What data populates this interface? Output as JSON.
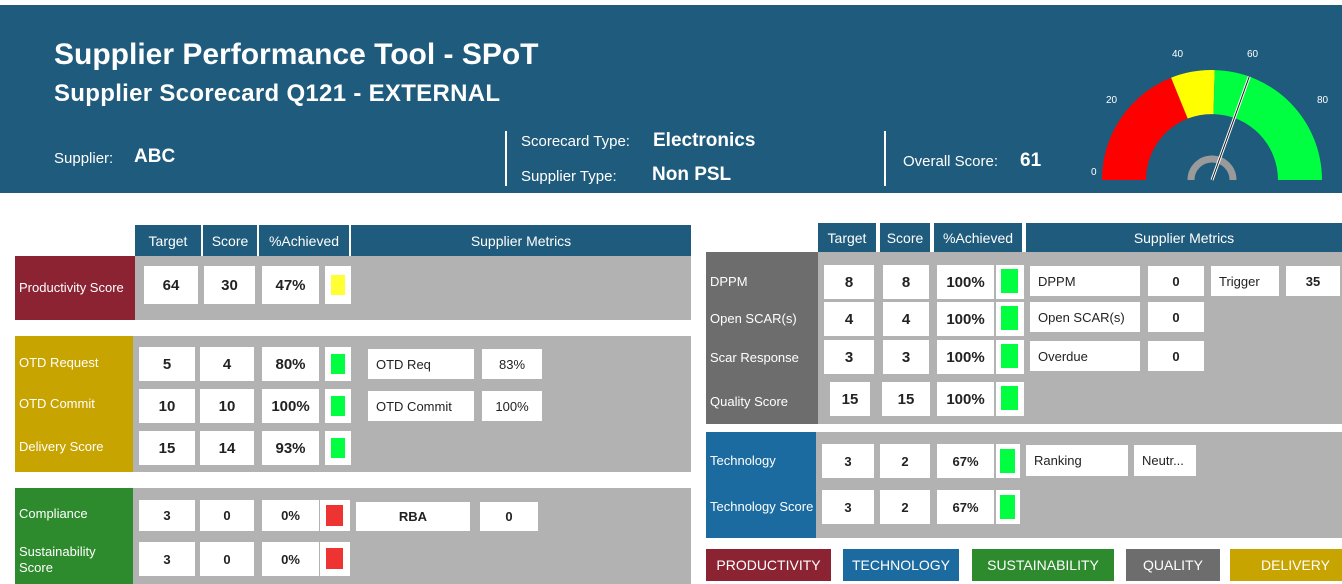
{
  "header": {
    "title": "Supplier Performance Tool - SPoT",
    "subtitle": "Supplier Scorecard Q121 - EXTERNAL",
    "supplier_label": "Supplier:",
    "supplier_value": "ABC",
    "scorecard_type_label": "Scorecard Type:",
    "scorecard_type_value": "Electronics",
    "supplier_type_label": "Supplier Type:",
    "supplier_type_value": "Non PSL",
    "overall_label": "Overall Score:",
    "overall_value": "61"
  },
  "gauge": {
    "ticks": [
      "0",
      "20",
      "40",
      "60",
      "80"
    ],
    "value": 61,
    "min": 0,
    "max": 100,
    "colors": {
      "red": "#ff0000",
      "yellow": "#ffff00",
      "green": "#00ff41"
    }
  },
  "left_headers": {
    "target": "Target",
    "score": "Score",
    "achieved": "%Achieved",
    "metrics": "Supplier Metrics"
  },
  "right_headers": {
    "target": "Target",
    "score": "Score",
    "achieved": "%Achieved",
    "metrics": "Supplier Metrics"
  },
  "productivity": {
    "label": "Productivity Score",
    "target": "64",
    "score": "30",
    "achieved": "47%",
    "status": "yellow"
  },
  "delivery": {
    "rows": [
      {
        "label": "OTD Request",
        "target": "5",
        "score": "4",
        "achieved": "80%",
        "status": "green",
        "metric_name": "OTD Req",
        "metric_value": "83%"
      },
      {
        "label": "OTD Commit",
        "target": "10",
        "score": "10",
        "achieved": "100%",
        "status": "green",
        "metric_name": "OTD Commit",
        "metric_value": "100%"
      },
      {
        "label": "Delivery Score",
        "target": "15",
        "score": "14",
        "achieved": "93%",
        "status": "green"
      }
    ]
  },
  "sustainability": {
    "rows": [
      {
        "label": "Compliance",
        "target": "3",
        "score": "0",
        "achieved": "0%",
        "status": "red",
        "metric_name": "RBA",
        "metric_value": "0"
      },
      {
        "label": "Sustainability Score",
        "target": "3",
        "score": "0",
        "achieved": "0%",
        "status": "red"
      }
    ]
  },
  "quality": {
    "rows": [
      {
        "label": "DPPM",
        "target": "8",
        "score": "8",
        "achieved": "100%",
        "status": "green",
        "metric_name": "DPPM",
        "metric_value": "0",
        "extra_name": "Trigger",
        "extra_value": "35"
      },
      {
        "label": "Open SCAR(s)",
        "target": "4",
        "score": "4",
        "achieved": "100%",
        "status": "green",
        "metric_name": "Open SCAR(s)",
        "metric_value": "0"
      },
      {
        "label": "Scar Response",
        "target": "3",
        "score": "3",
        "achieved": "100%",
        "status": "green",
        "metric_name": "Overdue",
        "metric_value": "0"
      },
      {
        "label": "Quality Score",
        "target": "15",
        "score": "15",
        "achieved": "100%",
        "status": "green"
      }
    ]
  },
  "technology": {
    "rows": [
      {
        "label": "Technology",
        "target": "3",
        "score": "2",
        "achieved": "67%",
        "status": "green",
        "metric_name": "Ranking",
        "metric_value": "Neutr..."
      },
      {
        "label": "Technology Score",
        "target": "3",
        "score": "2",
        "achieved": "67%",
        "status": "green"
      }
    ]
  },
  "legend": [
    {
      "label": "PRODUCTIVITY",
      "color": "#8b2333"
    },
    {
      "label": "TECHNOLOGY",
      "color": "#1b6aa0"
    },
    {
      "label": "SUSTAINABILITY",
      "color": "#2d8b2d"
    },
    {
      "label": "QUALITY",
      "color": "#6d6d6d"
    },
    {
      "label": "DELIVERY",
      "color": "#c8a400"
    }
  ],
  "colors": {
    "header_bg": "#1f5b7c",
    "productivity": "#8b2333",
    "delivery": "#c8a400",
    "sustainability": "#2d8b2d",
    "quality": "#6d6d6d",
    "technology": "#1b6aa0",
    "status_green": "#00ff41",
    "status_yellow": "#ffff33",
    "status_red": "#ee3333"
  }
}
